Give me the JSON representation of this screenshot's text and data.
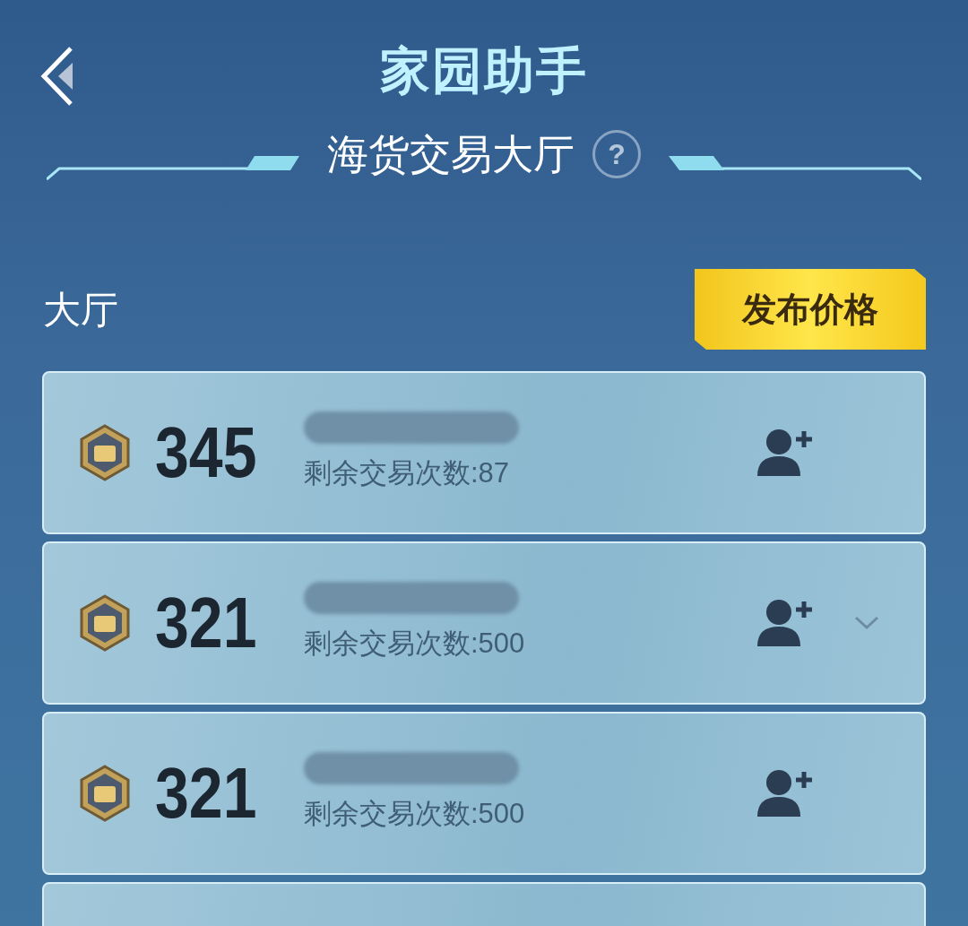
{
  "header": {
    "title": "家园助手"
  },
  "section": {
    "title": "海货交易大厅",
    "help": "?"
  },
  "hall": {
    "label": "大厅",
    "publish_button": "发布价格"
  },
  "rows": [
    {
      "price": "345",
      "remaining": "剩余交易次数:87",
      "chevron": false
    },
    {
      "price": "321",
      "remaining": "剩余交易次数:500",
      "chevron": true
    },
    {
      "price": "321",
      "remaining": "剩余交易次数:500",
      "chevron": false
    }
  ]
}
